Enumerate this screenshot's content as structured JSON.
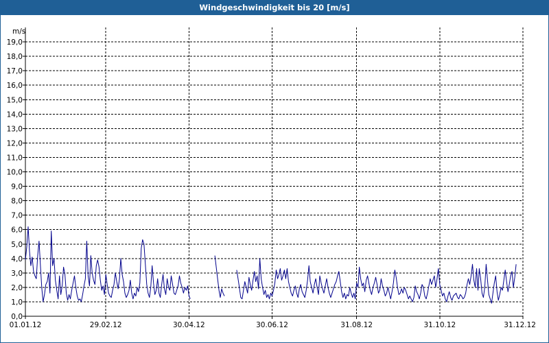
{
  "window": {
    "title": "Windgeschwindigkeit bis 20 [m/s]"
  },
  "chart_data": {
    "type": "line",
    "title": "Windgeschwindigkeit bis 20 [m/s]",
    "ylabel": "m/s",
    "ylim": [
      0,
      20
    ],
    "xlim_days": [
      0,
      365
    ],
    "grid": true,
    "y_ticks": [
      "0,0",
      "1,0",
      "2,0",
      "3,0",
      "4,0",
      "5,0",
      "6,0",
      "7,0",
      "8,0",
      "9,0",
      "10,0",
      "11,0",
      "12,0",
      "13,0",
      "14,0",
      "15,0",
      "16,0",
      "17,0",
      "18,0",
      "19,0"
    ],
    "x_ticks": [
      "01.01.12",
      "29.02.12",
      "30.04.12",
      "30.06.12",
      "31.08.12",
      "31.10.12",
      "31.12.12"
    ],
    "x_tick_days": [
      0,
      59,
      120,
      181,
      243,
      304,
      365
    ],
    "line_color": "#00008b",
    "series": [
      {
        "name": "",
        "segments": [
          {
            "start_day": 0,
            "values": [
              3.9,
              4.8,
              6.2,
              4.5,
              3.5,
              4.1,
              3.1,
              2.8,
              2.6,
              4.2,
              5.2,
              3.6,
              2.0,
              1.0,
              1.5,
              2.2,
              2.4,
              3.0,
              1.6,
              5.9,
              3.5,
              4.0,
              2.5,
              1.8,
              1.2,
              2.8,
              1.5,
              2.1,
              3.4,
              2.9,
              1.6,
              1.1,
              1.5,
              1.2,
              1.8,
              2.3,
              2.8,
              2.0,
              1.4,
              1.1,
              1.2,
              1.0,
              1.5,
              2.1,
              2.6,
              5.2,
              2.8,
              2.1,
              4.2,
              3.0,
              2.5,
              2.2,
              3.5,
              3.9,
              3.4,
              2.5,
              1.8,
              2.1,
              1.5,
              2.9,
              2.2,
              1.6,
              1.4,
              1.3,
              1.8,
              2.2,
              3.0,
              2.4,
              1.9,
              2.6,
              4.0,
              2.9,
              2.4,
              1.6,
              1.3,
              1.5,
              1.8,
              2.5,
              1.6,
              1.2,
              1.6,
              1.4,
              2.0,
              1.7,
              2.3,
              4.7,
              5.3,
              5.0,
              3.6,
              2.2,
              1.6,
              1.3,
              2.0,
              3.5,
              2.3,
              1.5,
              1.8,
              2.6,
              1.6,
              1.3,
              2.2,
              2.9,
              1.9,
              1.5,
              2.6,
              2.0,
              1.8,
              2.8,
              2.2,
              1.6,
              1.5,
              1.8,
              2.1,
              2.8,
              2.3,
              2.0,
              1.6,
              2.0,
              1.8,
              2.1,
              1.4,
              1.2
            ]
          },
          {
            "start_day": 139,
            "values": [
              4.2,
              3.4,
              2.6,
              1.8,
              1.3,
              1.9,
              1.6,
              1.4
            ]
          },
          {
            "start_day": 155,
            "values": [
              3.2,
              2.6,
              2.0,
              1.3,
              1.2,
              1.8,
              2.4,
              2.0,
              1.6,
              2.7,
              2.2,
              1.8,
              2.5,
              3.1,
              2.4,
              2.8,
              1.9,
              4.0,
              2.6,
              2.0,
              1.5,
              1.8,
              1.3,
              1.5,
              1.2,
              1.6,
              1.4,
              1.8,
              2.3,
              3.2,
              2.6,
              2.9,
              3.3,
              2.5,
              2.8,
              3.2,
              2.6,
              3.3,
              2.4,
              2.0,
              1.6,
              1.4,
              1.8,
              2.1,
              1.6,
              1.3,
              1.9,
              2.2,
              1.7,
              1.5,
              1.3,
              1.8,
              2.5,
              3.5,
              2.4,
              2.0,
              1.6,
              2.2,
              2.6,
              2.0,
              1.5,
              2.8,
              2.3,
              1.9,
              1.6,
              2.1,
              2.6,
              2.0,
              1.6,
              1.3,
              1.6,
              1.9,
              2.2,
              2.4,
              2.8,
              3.1,
              2.4,
              1.7,
              1.3,
              1.6,
              1.2,
              1.5,
              1.4,
              2.0,
              1.6,
              1.3,
              1.6,
              1.2,
              2.3,
              2.0,
              3.4,
              2.6,
              2.1,
              2.3,
              1.7,
              2.5,
              2.8,
              2.3,
              1.8,
              1.5,
              2.0,
              2.3,
              2.7,
              2.2,
              1.6,
              1.8,
              2.6,
              2.1,
              1.8,
              1.4,
              1.6,
              2.0,
              1.6,
              1.2,
              1.7,
              2.3,
              3.2,
              2.7,
              2.0,
              1.5,
              1.6,
              1.9,
              1.6,
              2.0,
              1.8,
              1.5,
              1.2,
              1.4,
              1.2,
              1.0,
              1.3,
              2.1,
              1.7,
              1.5,
              1.2,
              1.6,
              2.2,
              2.0,
              1.4,
              1.2,
              1.6,
              2.1,
              2.6,
              2.2,
              2.5,
              2.8,
              2.0,
              2.6,
              3.3,
              2.2,
              1.8,
              1.4,
              1.6,
              1.2,
              1.0,
              1.4,
              1.7,
              1.3,
              1.1,
              1.4,
              1.5,
              1.6,
              1.3,
              1.2,
              1.5,
              1.4,
              1.2,
              1.3,
              1.6,
              2.2,
              2.6,
              2.2,
              2.8,
              3.6,
              2.5,
              2.0,
              3.3,
              1.8,
              3.3,
              2.6,
              1.6,
              1.3,
              2.0,
              3.6,
              2.5,
              1.5,
              1.2,
              0.9,
              1.6,
              2.3,
              2.8,
              1.7,
              1.1,
              1.5,
              2.0,
              1.8,
              2.5,
              3.2,
              2.4,
              1.7,
              2.2,
              2.8,
              3.1,
              2.0,
              2.7,
              3.6
            ]
          }
        ]
      }
    ]
  }
}
